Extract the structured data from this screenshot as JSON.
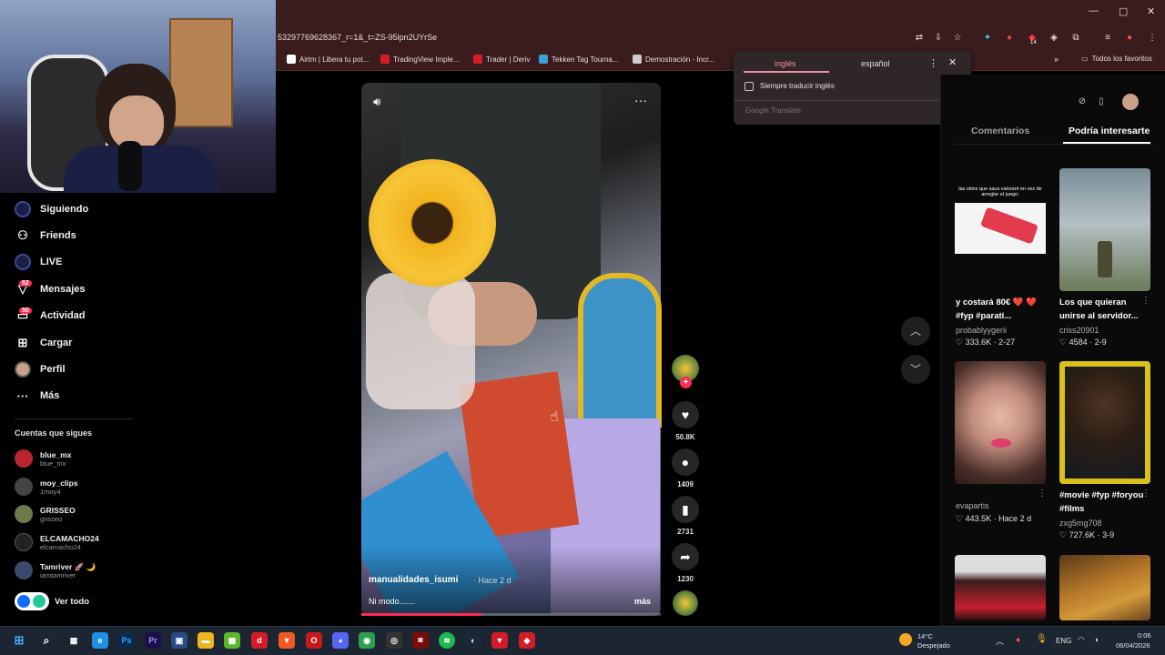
{
  "browser": {
    "url": "53297769628367_r=1&_t=ZS-95lpn2UYrSe",
    "bookmarks": [
      {
        "label": "Airtm | Libera tu pot...",
        "color": "#ffffff"
      },
      {
        "label": "TradingView Imple...",
        "color": "#d31c27"
      },
      {
        "label": "Trader | Deriv",
        "color": "#d31c27"
      },
      {
        "label": "Tekken Tag Tourna...",
        "color": "#3aa0d8"
      },
      {
        "label": "Demostración - Incr...",
        "color": "#cccccc"
      }
    ],
    "all_favorites": "Todos los favoritos",
    "extension_badge": "14"
  },
  "translate_popup": {
    "tab_source": "inglés",
    "tab_target": "español",
    "always_label": "Siempre traducir inglés",
    "footer": "Google Translate"
  },
  "sidebar": {
    "items": [
      {
        "label": "Siguiendo",
        "icon": "avatar-icon"
      },
      {
        "label": "Friends",
        "icon": "friends-icon"
      },
      {
        "label": "LIVE",
        "icon": "live-icon"
      },
      {
        "label": "Mensajes",
        "icon": "messages-icon",
        "badge": "52"
      },
      {
        "label": "Actividad",
        "icon": "activity-icon",
        "badge": "50"
      },
      {
        "label": "Cargar",
        "icon": "upload-icon"
      },
      {
        "label": "Perfil",
        "icon": "profile-icon"
      },
      {
        "label": "Más",
        "icon": "more-icon"
      }
    ],
    "following_title": "Cuentas que sigues",
    "accounts": [
      {
        "name": "blue_mx",
        "user": "blue_mx",
        "color": "#b9242f"
      },
      {
        "name": "moy_clips",
        "user": "1moy4",
        "color": "#444444"
      },
      {
        "name": "GRISSEO",
        "user": "grisseo",
        "color": "#6f7a4a"
      },
      {
        "name": "ELCAMACHO24",
        "user": "elcamacho24",
        "color": "#222222"
      },
      {
        "name": "Tamriver 🚀 🌙",
        "user": "iamtamriver",
        "color": "#3b4a6b"
      }
    ],
    "see_all": "Ver todo"
  },
  "video": {
    "username": "manualidades_isumi",
    "time": "· Hace 2 d",
    "description": "Ni modo.......",
    "more": "más",
    "progress": 0.4
  },
  "actions": {
    "likes": "50.8K",
    "comments": "1409",
    "saves": "2731",
    "shares": "1230"
  },
  "right_panel": {
    "tab_comments": "Comentarios",
    "tab_suggested": "Podría interesarte",
    "cards": [
      {
        "thumb_text": "las skins que saca valorant en vez de arreglar el juego:",
        "caption": "y costará 80€ ❤️ ❤️ #fyp #parati...",
        "user": "probablyygerii",
        "stats": "♡ 333.6K · 2-27",
        "bg": "#f4f4f4"
      },
      {
        "thumb_text": "",
        "caption": "Los que quieran unirse al servidor...",
        "user": "criss20901",
        "stats": "♡ 4584 · 2-9",
        "bg": "#9aa8ae"
      },
      {
        "thumb_text": "",
        "caption": "",
        "user": "evapartis",
        "stats": "♡ 443.5K · Hace 2 d",
        "bg": "#c28d7e"
      },
      {
        "thumb_text": "",
        "caption": "#movie #fyp #foryou #films",
        "user": "zxg5mg708",
        "stats": "♡ 727.6K · 3-9",
        "bg": "#3b2a1a"
      },
      {
        "thumb_text": "",
        "caption": "",
        "user": "",
        "stats": "",
        "bg": "#2a2020"
      },
      {
        "thumb_text": "",
        "caption": "",
        "user": "",
        "stats": "",
        "bg": "#8a5a1a"
      }
    ]
  },
  "taskbar": {
    "weather_temp": "14°C",
    "weather_desc": "Despejado",
    "lang": "ENG",
    "time": "0:06",
    "date": "06/04/2026"
  }
}
